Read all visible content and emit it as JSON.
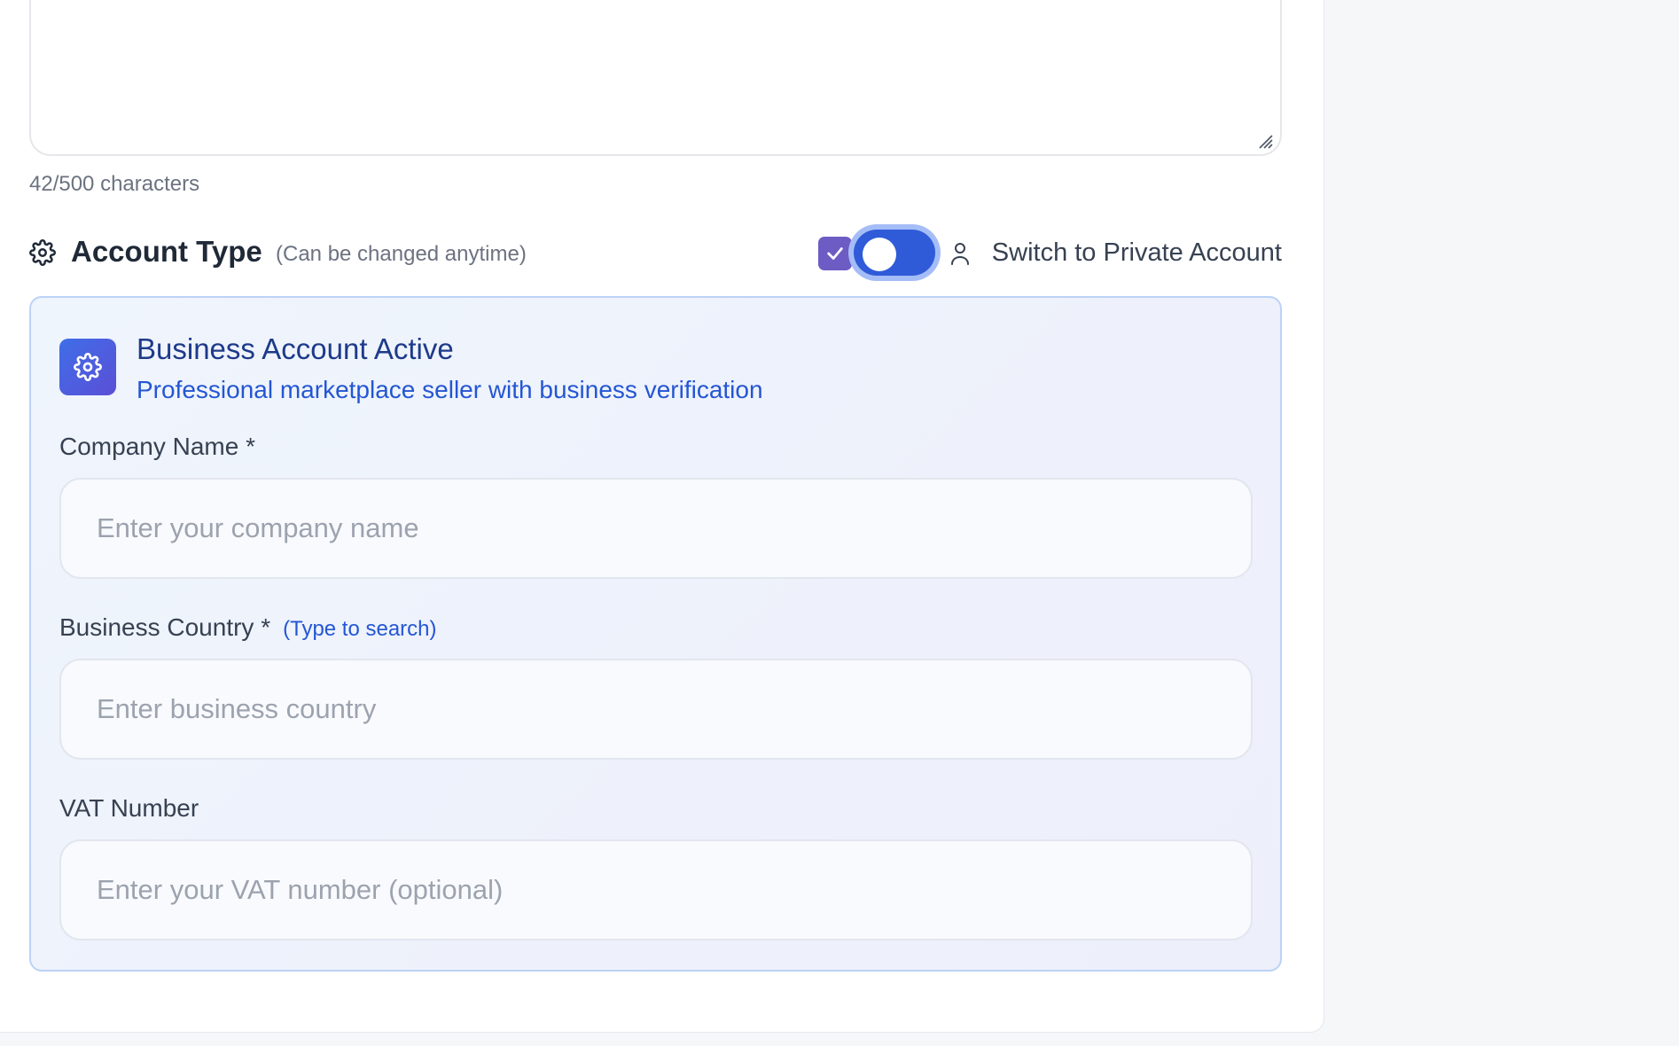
{
  "description_field": {
    "char_count": "42/500 characters"
  },
  "account_type": {
    "title": "Account Type",
    "note": "(Can be changed anytime)",
    "toggle_checked": true,
    "switch_label": "Switch to Private Account"
  },
  "business_panel": {
    "title": "Business Account Active",
    "subtitle": "Professional marketplace seller with business verification",
    "fields": [
      {
        "label": "Company Name *",
        "hint": "",
        "placeholder": "Enter your company name",
        "value": ""
      },
      {
        "label": "Business Country *",
        "hint": "(Type to search)",
        "placeholder": "Enter business country",
        "value": ""
      },
      {
        "label": "VAT Number",
        "hint": "",
        "placeholder": "Enter your VAT number (optional)",
        "value": ""
      }
    ]
  },
  "colors": {
    "accent": "#2f5bd8",
    "panel_border": "#bcd2f6",
    "link_blue": "#2456d3",
    "title_navy": "#1e3a8a"
  },
  "icons": {
    "section": "gear-icon",
    "badge": "gear-icon",
    "switch_label": "user-icon",
    "checkbox": "check-icon"
  }
}
